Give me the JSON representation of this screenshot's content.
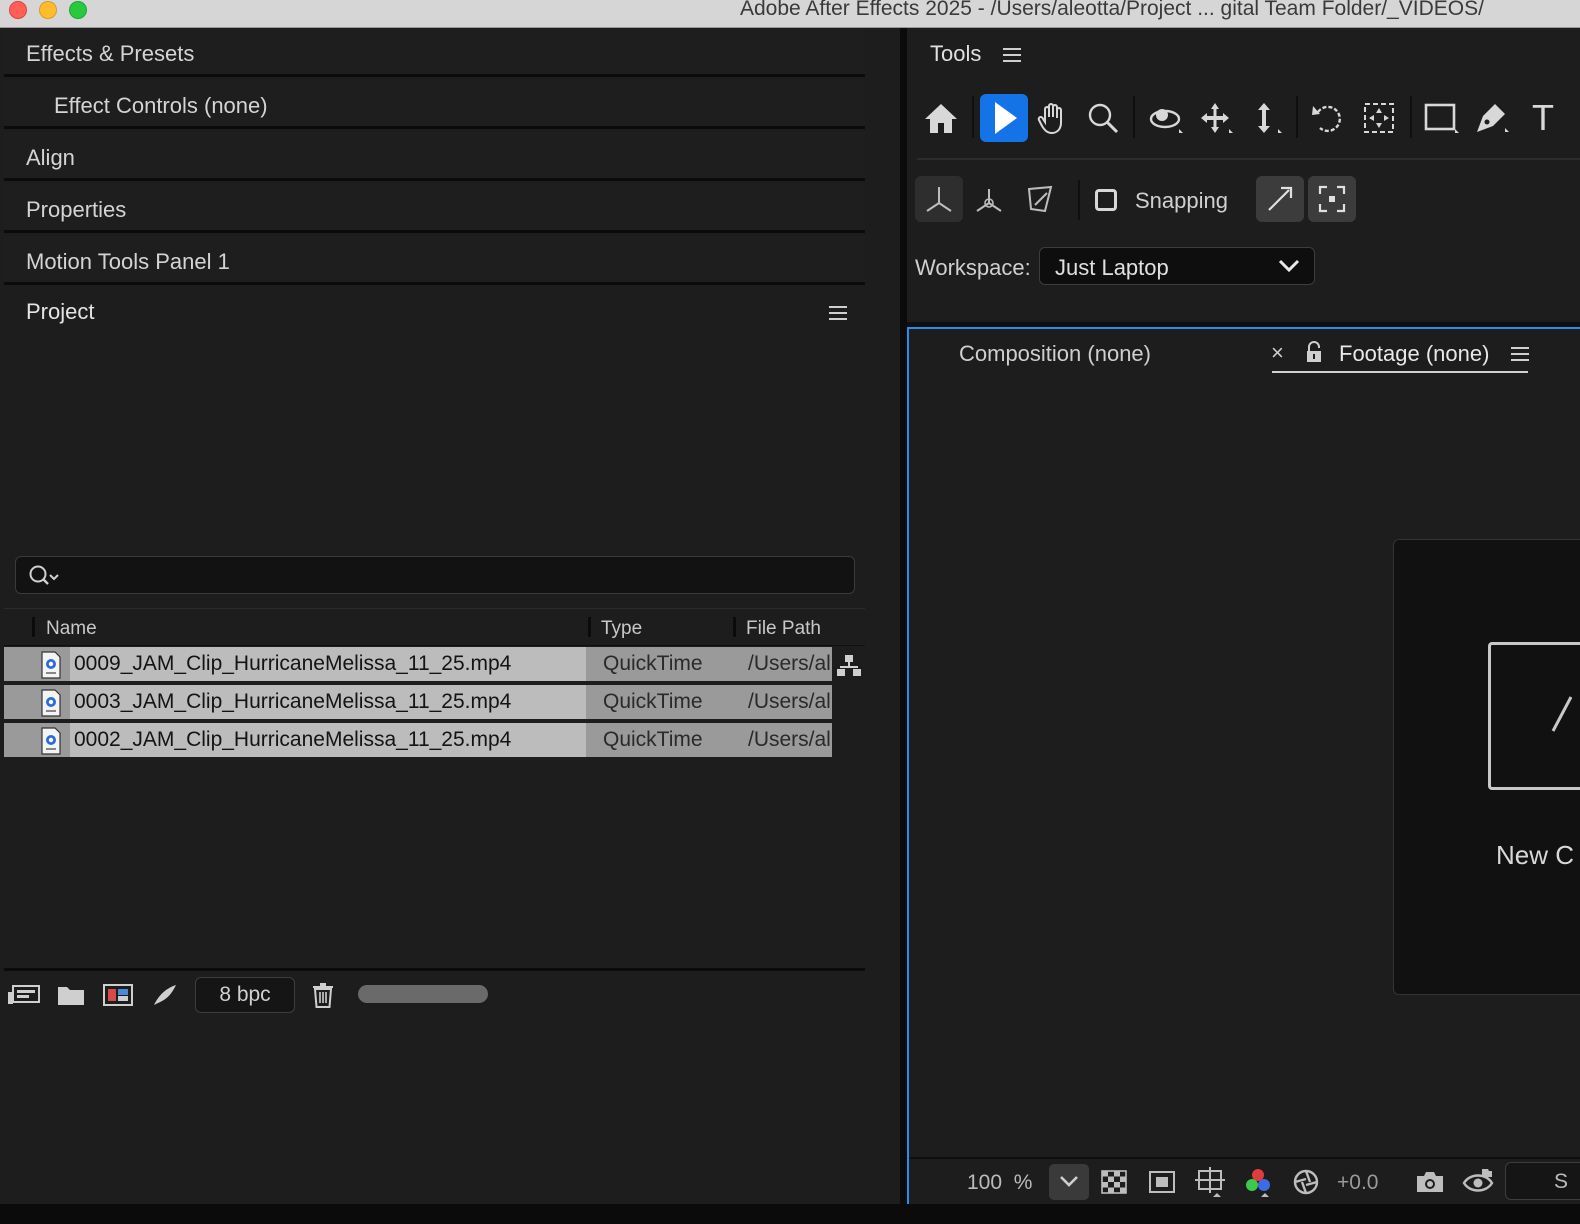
{
  "window": {
    "title": "Adobe After Effects 2025 - /Users/aleotta/Project ... gital Team Folder/_VIDEOS/"
  },
  "left_panel": {
    "tabs": [
      {
        "label": "Effects & Presets"
      },
      {
        "label": "Effect Controls (none)"
      },
      {
        "label": "Align"
      },
      {
        "label": "Properties"
      },
      {
        "label": "Motion Tools Panel 1"
      }
    ],
    "project": {
      "title": "Project",
      "search_placeholder": "",
      "columns": {
        "name": "Name",
        "type": "Type",
        "path": "File Path"
      },
      "items": [
        {
          "name": "0009_JAM_Clip_HurricaneMelissa_11_25.mp4",
          "type": "QuickTime",
          "path": "/Users/al"
        },
        {
          "name": "0003_JAM_Clip_HurricaneMelissa_11_25.mp4",
          "type": "QuickTime",
          "path": "/Users/al"
        },
        {
          "name": "0002_JAM_Clip_HurricaneMelissa_11_25.mp4",
          "type": "QuickTime",
          "path": "/Users/al"
        }
      ],
      "bit_depth": "8 bpc"
    }
  },
  "tools_panel": {
    "title": "Tools",
    "snapping_label": "Snapping",
    "workspace_label": "Workspace:",
    "workspace_value": "Just Laptop",
    "type_tool_glyph": "T"
  },
  "viewer": {
    "composition_tab": "Composition (none)",
    "close_glyph": "×",
    "footage_tab": "Footage (none)",
    "new_comp_label": "New C",
    "zoom_value": "100",
    "zoom_unit": "%",
    "exposure": "+0.0",
    "snap_field_text": "S"
  },
  "colors": {
    "accent": "#1473e6",
    "panel_focus": "#2d8ceb"
  }
}
